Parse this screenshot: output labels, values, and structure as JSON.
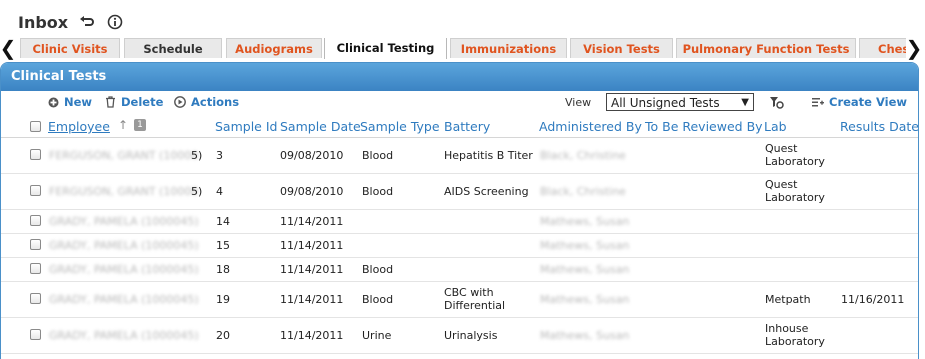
{
  "title": "Inbox",
  "nav": {
    "prev_arrow": "❮",
    "next_arrow": "❯"
  },
  "tabs": [
    {
      "label": "Clinic Visits"
    },
    {
      "label": "Schedule"
    },
    {
      "label": "Audiograms"
    },
    {
      "label": "Clinical Testing"
    },
    {
      "label": "Immunizations"
    },
    {
      "label": "Vision Tests"
    },
    {
      "label": "Pulmonary Function Tests"
    },
    {
      "label": "Ches"
    }
  ],
  "panel": {
    "title": "Clinical Tests"
  },
  "toolbar": {
    "new_label": "New",
    "delete_label": "Delete",
    "actions_label": "Actions",
    "view_label": "View",
    "view_value": "All Unsigned Tests",
    "create_view_label": "Create View"
  },
  "columns": {
    "employee": "Employee",
    "sort_badge": "1",
    "sample_id": "Sample Id",
    "sample_date": "Sample Date",
    "sample_type": "Sample Type",
    "battery": "Battery",
    "administered_by": "Administered By",
    "to_be_reviewed_by": "To Be Reviewed By",
    "lab": "Lab",
    "results_date": "Results Date"
  },
  "rows": [
    {
      "employee": "FERGUSON, GRANT (10000",
      "employee_tail": "5)",
      "sample_id": "3",
      "sample_date": "09/08/2010",
      "sample_type": "Blood",
      "battery": "Hepatitis B Titer",
      "administered_by": "Black, Christine",
      "lab": "Quest Laboratory",
      "results_date": ""
    },
    {
      "employee": "FERGUSON, GRANT (10000",
      "employee_tail": "5)",
      "sample_id": "4",
      "sample_date": "09/08/2010",
      "sample_type": "Blood",
      "battery": "AIDS Screening",
      "administered_by": "Black, Christine",
      "lab": "Quest Laboratory",
      "results_date": ""
    },
    {
      "employee": "GRADY, PAMELA (1000045)",
      "employee_tail": "",
      "sample_id": "14",
      "sample_date": "11/14/2011",
      "sample_type": "",
      "battery": "",
      "administered_by": "Mathews, Susan",
      "lab": "",
      "results_date": ""
    },
    {
      "employee": "GRADY, PAMELA (1000045)",
      "employee_tail": "",
      "sample_id": "15",
      "sample_date": "11/14/2011",
      "sample_type": "",
      "battery": "",
      "administered_by": "Mathews, Susan",
      "lab": "",
      "results_date": ""
    },
    {
      "employee": "GRADY, PAMELA (1000045)",
      "employee_tail": "",
      "sample_id": "18",
      "sample_date": "11/14/2011",
      "sample_type": "Blood",
      "battery": "",
      "administered_by": "Mathews, Susan",
      "lab": "",
      "results_date": ""
    },
    {
      "employee": "GRADY, PAMELA (1000045)",
      "employee_tail": "",
      "sample_id": "19",
      "sample_date": "11/14/2011",
      "sample_type": "Blood",
      "battery": "CBC with Differential",
      "administered_by": "Mathews, Susan",
      "lab": "Metpath",
      "results_date": "11/16/2011"
    },
    {
      "employee": "GRADY, PAMELA (1000045)",
      "employee_tail": "",
      "sample_id": "20",
      "sample_date": "11/14/2011",
      "sample_type": "Urine",
      "battery": "Urinalysis",
      "administered_by": "Mathews, Susan",
      "lab": "Inhouse Laboratory",
      "results_date": ""
    }
  ],
  "colors": {
    "accent": "#2f7bbf",
    "tab_text": "#e0541f",
    "panel_header": "#3b83c3"
  }
}
